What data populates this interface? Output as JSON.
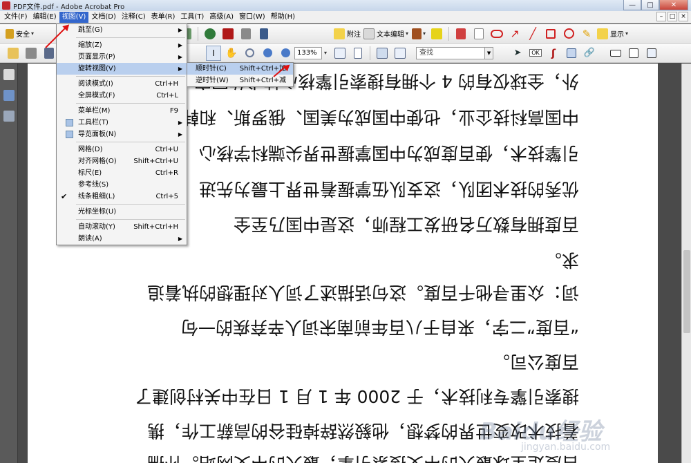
{
  "window": {
    "title": "PDF文件.pdf - Adobe Acrobat Pro",
    "minimize": "—",
    "maximize": "□",
    "close": "✕"
  },
  "menubar": {
    "items": [
      "文件(F)",
      "编辑(E)",
      "视图(V)",
      "文档(D)",
      "注释(C)",
      "表单(R)",
      "工具(T)",
      "高级(A)",
      "窗口(W)",
      "帮助(H)"
    ],
    "active_index": 2,
    "right_buttons": [
      "–",
      "□",
      "×"
    ]
  },
  "toolbar1": {
    "security_label": "安全",
    "comment_label": "附注",
    "text_edit_label": "文本编辑",
    "display_label": "显示"
  },
  "toolbar2": {
    "zoom_value": "133%",
    "search_placeholder": "查找"
  },
  "view_menu": {
    "items": [
      {
        "label": "跳至(G)",
        "shortcut": "",
        "submenu": true
      },
      {
        "label": "缩放(Z)",
        "shortcut": "",
        "submenu": true
      },
      {
        "label": "页面显示(P)",
        "shortcut": "",
        "submenu": true
      },
      {
        "label": "旋转视图(V)",
        "shortcut": "",
        "submenu": true,
        "highlighted": true
      },
      {
        "label": "阅读模式(I)",
        "shortcut": "Ctrl+H"
      },
      {
        "label": "全屏模式(F)",
        "shortcut": "Ctrl+L"
      },
      {
        "label": "菜单栏(M)",
        "shortcut": "F9"
      },
      {
        "label": "工具栏(T)",
        "shortcut": "",
        "submenu": true
      },
      {
        "label": "导览面板(N)",
        "shortcut": "",
        "submenu": true
      },
      {
        "label": "网格(D)",
        "shortcut": "Ctrl+U"
      },
      {
        "label": "对齐网格(O)",
        "shortcut": "Shift+Ctrl+U"
      },
      {
        "label": "标尺(E)",
        "shortcut": "Ctrl+R"
      },
      {
        "label": "参考线(S)",
        "shortcut": ""
      },
      {
        "label": "线条粗细(L)",
        "shortcut": "Ctrl+5",
        "checked": true
      },
      {
        "label": "光标坐标(U)",
        "shortcut": ""
      },
      {
        "label": "自动滚动(Y)",
        "shortcut": "Shift+Ctrl+H"
      },
      {
        "label": "朗读(A)",
        "shortcut": "",
        "submenu": true
      }
    ]
  },
  "rotate_submenu": {
    "items": [
      {
        "label": "顺时针(C)",
        "shortcut": "Shift+Ctrl+加",
        "highlighted": true
      },
      {
        "label": "逆时针(W)",
        "shortcut": "Shift+Ctrl+减"
      }
    ]
  },
  "document": {
    "lines": [
      "外，全球仅有的 4 个拥有搜索引擎核心技术的国家之",
      "中国高科技企业，也使中国成为美国、俄罗斯、和韩",
      "引擎技术，使百度成为中国掌握世界尖端科学核心",
      "优秀的技术团队，这支队伍掌握着世界上最为先进",
      "百度拥有数万名研发工程师，这是中国乃至全",
      "求。",
      "词：众里寻他千百度。这句话描述了词人对理想的执着追",
      "“百度”二字，来自于八百年前南宋词人辛弃疾的一句",
      "百度公司。",
      "搜索引擎专利技术，于 2000 年 1 月 1 日在中关村创建了",
      "着技术改变世界的梦想，他毅然辞掉硅谷的高薪工作，携",
      "百度是全球最大的中文搜索引擎，最大的中文网站。怀揣"
    ]
  },
  "watermark": {
    "brand": "Baidu经验",
    "url": "jingyan.baidu.com"
  }
}
